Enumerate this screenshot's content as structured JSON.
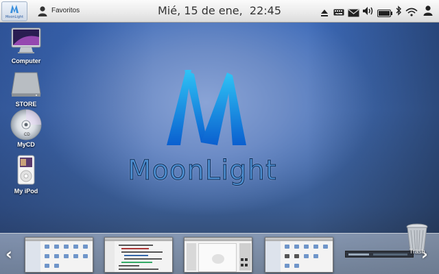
{
  "topbar": {
    "menu_logo_caption": "MoonLight",
    "places_label": "Favoritos",
    "clock": "Mié, 15 de ene,  22:45",
    "tray_icons": [
      "eject-icon",
      "keyboard-icon",
      "mail-icon",
      "volume-icon",
      "battery-icon",
      "bluetooth-icon",
      "wifi-icon",
      "user-icon"
    ],
    "keyboard_caption": "ES"
  },
  "desktop": {
    "icons": [
      {
        "label": "Computer",
        "icon": "monitor-icon"
      },
      {
        "label": "STORE",
        "icon": "drive-icon"
      },
      {
        "label": "MyCD",
        "icon": "cd-icon"
      },
      {
        "label": "My iPod",
        "icon": "ipod-icon"
      }
    ],
    "cd_caption": "CD",
    "brand": "MoonLight",
    "accent_color": "#3aa3e6"
  },
  "dock": {
    "left_arrow": "‹",
    "right_arrow": "›",
    "windows": [
      "file-manager-window",
      "text-editor-window",
      "image-editor-window",
      "file-manager-window-2",
      "media-player-window"
    ],
    "trash_label": "Trash"
  }
}
